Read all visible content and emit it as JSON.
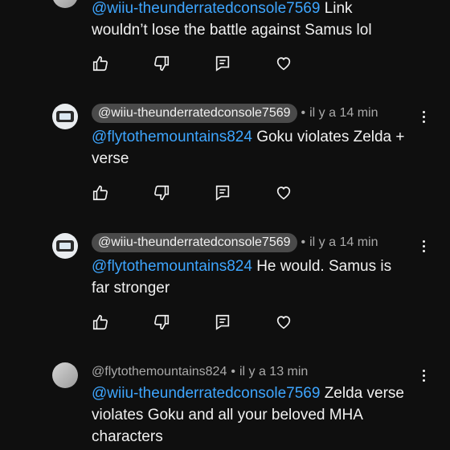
{
  "comments": [
    {
      "author": "",
      "time": "",
      "mention": "@wiiu-theunderratedconsole7569",
      "text": " Link wouldn’t lose the battle against Samus lol",
      "line2": "wouldn’t lose the battle against Samus lol",
      "line1_rest": "Link"
    },
    {
      "author": "@wiiu-theunderratedconsole7569",
      "time": "il y a 14 min",
      "mention": "@flytothemountains824",
      "line1_rest": "Goku violates Zelda +",
      "line2": "verse"
    },
    {
      "author": "@wiiu-theunderratedconsole7569",
      "time": "il y a 14 min",
      "mention": "@flytothemountains824",
      "line1_rest": "He would. Samus is",
      "line2": "far stronger"
    },
    {
      "author": "@flytothemountains824",
      "time": "il y a 13 min",
      "mention": "@wiiu-theunderratedconsole7569",
      "line1_rest": "Zelda verse",
      "line2": "violates Goku and all your beloved MHA",
      "line3": "characters"
    }
  ],
  "icons": {
    "like": "thumbs-up-icon",
    "dislike": "thumbs-down-icon",
    "reply": "reply-comment-icon",
    "heart": "heart-icon",
    "more": "more-vertical-icon"
  },
  "colors": {
    "background": "#0f0f0f",
    "mention": "#3ea6ff",
    "text": "#f1f1f1",
    "muted": "#aaaaaa",
    "pill": "#4a4a4a"
  },
  "separator": "•"
}
